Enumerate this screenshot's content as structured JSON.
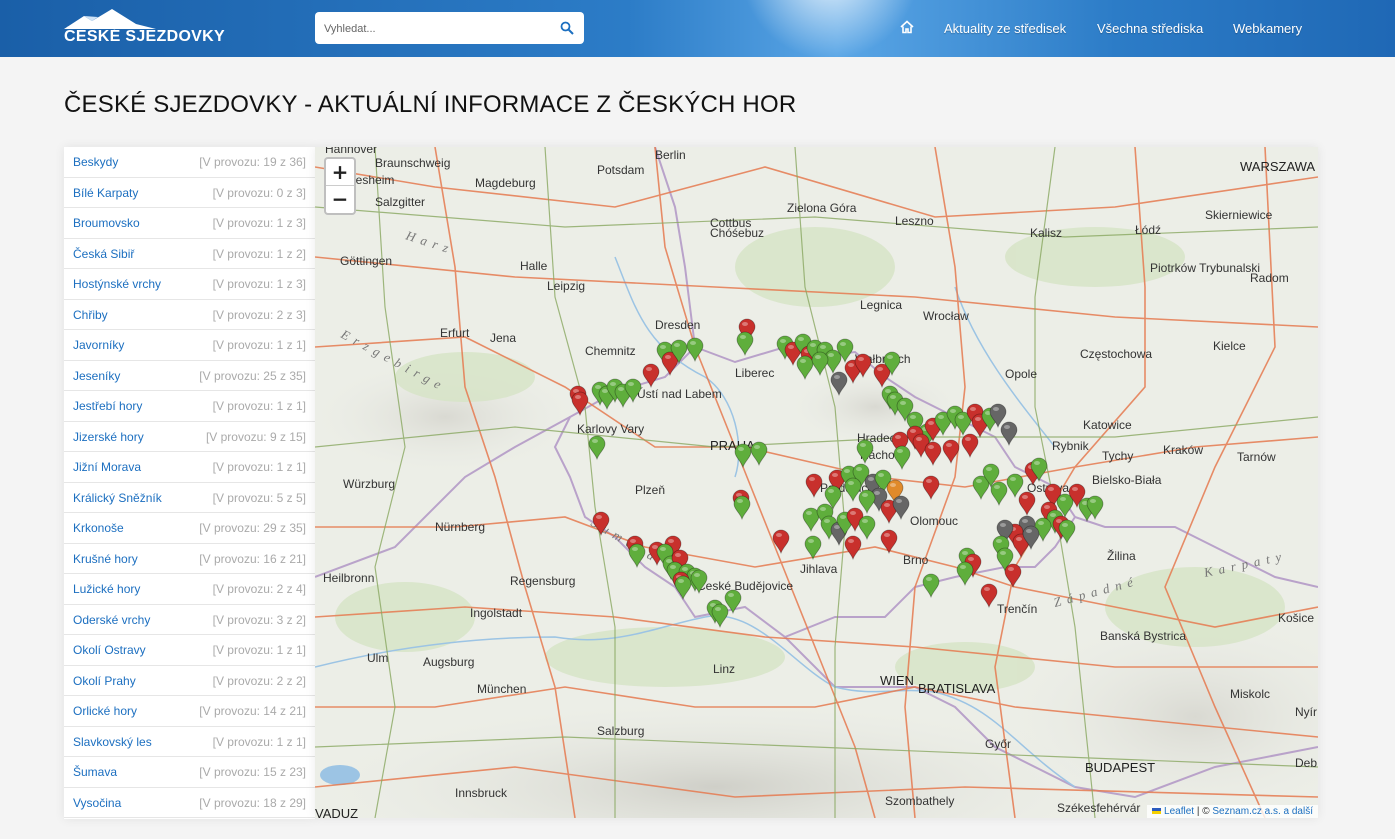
{
  "header": {
    "logo_text": "ČESKÉ SJEZDOVKY",
    "search_placeholder": "Vyhledat...",
    "nav": {
      "news": "Aktuality ze středisek",
      "all": "Všechna střediska",
      "webcams": "Webkamery"
    },
    "brand_color": "#1a5fa8"
  },
  "page_title": "ČESKÉ SJEZDOVKY - AKTUÁLNÍ INFORMACE Z ČESKÝCH HOR",
  "regions": [
    {
      "name": "Beskydy",
      "status": "[V provozu: 19 z 36]"
    },
    {
      "name": "Bílé Karpaty",
      "status": "[V provozu: 0 z 3]"
    },
    {
      "name": "Broumovsko",
      "status": "[V provozu: 1 z 3]"
    },
    {
      "name": "Česká Sibiř",
      "status": "[V provozu: 1 z 2]"
    },
    {
      "name": "Hostýnské vrchy",
      "status": "[V provozu: 1 z 3]"
    },
    {
      "name": "Chřiby",
      "status": "[V provozu: 2 z 3]"
    },
    {
      "name": "Javorníky",
      "status": "[V provozu: 1 z 1]"
    },
    {
      "name": "Jeseníky",
      "status": "[V provozu: 25 z 35]"
    },
    {
      "name": "Jestřebí hory",
      "status": "[V provozu: 1 z 1]"
    },
    {
      "name": "Jizerské hory",
      "status": "[V provozu: 9 z 15]"
    },
    {
      "name": "Jižní Morava",
      "status": "[V provozu: 1 z 1]"
    },
    {
      "name": "Králický Sněžník",
      "status": "[V provozu: 5 z 5]"
    },
    {
      "name": "Krkonoše",
      "status": "[V provozu: 29 z 35]"
    },
    {
      "name": "Krušné hory",
      "status": "[V provozu: 16 z 21]"
    },
    {
      "name": "Lužické hory",
      "status": "[V provozu: 2 z 4]"
    },
    {
      "name": "Oderské vrchy",
      "status": "[V provozu: 3 z 2]"
    },
    {
      "name": "Okolí Ostravy",
      "status": "[V provozu: 1 z 1]"
    },
    {
      "name": "Okolí Prahy",
      "status": "[V provozu: 2 z 2]"
    },
    {
      "name": "Orlické hory",
      "status": "[V provozu: 14 z 21]"
    },
    {
      "name": "Slavkovský les",
      "status": "[V provozu: 1 z 1]"
    },
    {
      "name": "Šumava",
      "status": "[V provozu: 15 z 23]"
    },
    {
      "name": "Vysočina",
      "status": "[V provozu: 18 z 29]"
    }
  ],
  "map": {
    "zoom_in": "+",
    "zoom_out": "−",
    "attribution_leaflet": "Leaflet",
    "attribution_sep": " | © ",
    "attribution_source": "Seznam.cz a.s. a další",
    "marker_colors": {
      "open": "#5fae3c",
      "closed": "#c8302c",
      "unknown": "#666666",
      "other": "#e08a2a"
    },
    "cities": [
      "Hannover",
      "Braunschweig",
      "Potsdam",
      "Berlin",
      "Magdeburg",
      "Hildesheim",
      "Salzgitter",
      "Cottbus",
      "Chóśebuz",
      "Zielona Góra",
      "Leszno",
      "Kalisz",
      "Łódź",
      "WARSZAWA",
      "Piotrków Trybunalski",
      "Radom",
      "Skierniewice",
      "Göttingen",
      "Halle",
      "Leipzig",
      "Legnica",
      "Wrocław",
      "Erfurt",
      "Jena",
      "Dresden",
      "Chemnitz",
      "Wałbrzych",
      "Opole",
      "Częstochowa",
      "Kielce",
      "Liberec",
      "Ústí nad Labem",
      "Karlovy Vary",
      "PRAHA",
      "Hradec",
      "Náchod",
      "Katowice",
      "Rybnik",
      "Tychy",
      "Kraków",
      "Tarnów",
      "Bielsko-Biała",
      "Würzburg",
      "Plzeň",
      "Pardubice",
      "Ostrava",
      "Olomouc",
      "Nürnberg",
      "Jihlava",
      "Brno",
      "Žilina",
      "Heilbronn",
      "Regensburg",
      "České Budějovice",
      "Ingolstadt",
      "Trenčín",
      "Košice",
      "Ulm",
      "Augsburg",
      "Linz",
      "Banská Bystrica",
      "München",
      "WIEN",
      "BRATISLAVA",
      "Miskolc",
      "Salzburg",
      "Győr",
      "Nyír",
      "BUDAPEST",
      "Innsbruck",
      "Szombathely",
      "Székesfehérvár",
      "VADUZ",
      "Deb"
    ],
    "region_labels": [
      "Harz",
      "Erzgebirge",
      "Karpaty",
      "Západné",
      "Šumava"
    ]
  }
}
